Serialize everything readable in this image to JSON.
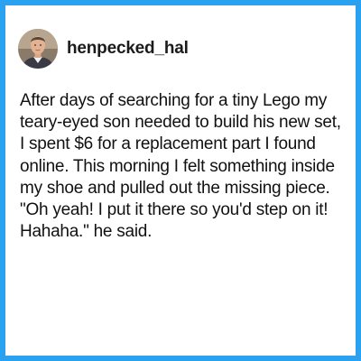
{
  "post": {
    "username": "henpecked_hal",
    "avatar_icon": "user-photo-avatar",
    "text": "After days of searching for a tiny Lego my teary-eyed son needed to build his new set, I spent $6 for a replacement part I found online. This morning I felt something inside my shoe and pulled out the missing piece. \"Oh yeah! I put it there so you'd step on it! Hahaha.\" he said."
  },
  "colors": {
    "border": "#2aa2f0",
    "card": "#ffffff",
    "text": "#111111"
  }
}
